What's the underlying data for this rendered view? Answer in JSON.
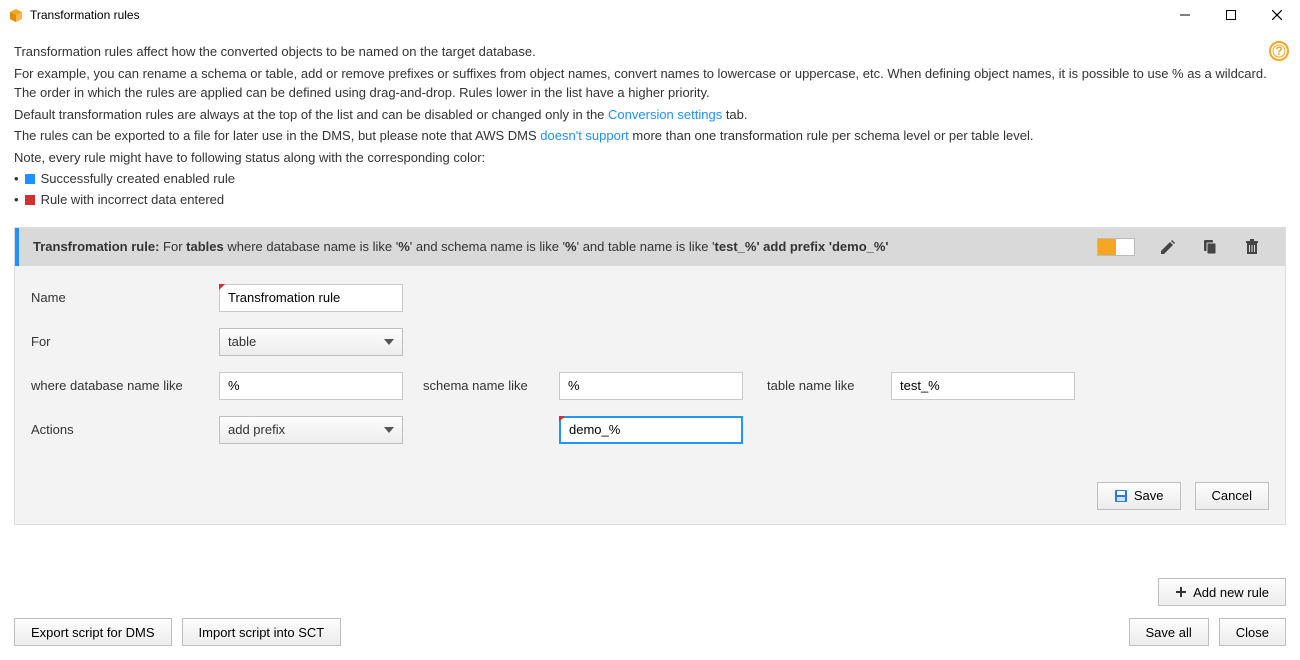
{
  "titlebar": {
    "title": "Transformation rules"
  },
  "intro": {
    "line1": "Transformation rules affect how the converted objects to be named on the target database.",
    "line2a": "For example, you can rename a schema or table, add or remove prefixes or suffixes from object names, convert names to lowercase or uppercase, etc. When defining object names, it is possible to use % as a wildcard. The order in which the rules are applied can be defined using drag-and-drop. Rules lower in the list have a higher priority.",
    "line3a": "Default transformation rules are always at the top of the list and can be disabled or changed only in the ",
    "line3_link": "Conversion settings",
    "line3b": "  tab.",
    "line4a": "The rules can be exported to a file for later use in the DMS, but please note that AWS DMS ",
    "line4_link": "doesn't support",
    "line4b": "  more than one transformation rule per schema level or per table level.",
    "line5": "Note, every rule might have to following status along with the corresponding color:",
    "bullet1": "Successfully created enabled rule",
    "bullet2": "Rule with incorrect data entered"
  },
  "rule": {
    "header_prefix": "Transfromation rule:",
    "header_for": " For  ",
    "header_tables": "tables",
    "header_mid1": "  where database name is like '",
    "header_pct1": "%",
    "header_mid2": "' and schema name is like '",
    "header_pct2": "%",
    "header_mid3": "' and table name is like '",
    "header_testpct": "test_%' add prefix 'demo_%'",
    "form": {
      "label_name": "Name",
      "value_name": "Transfromation rule",
      "label_for": "For",
      "value_for": "table",
      "label_dbname": "where database name like",
      "value_dbname": "%",
      "label_schema": "schema name like",
      "value_schema": "%",
      "label_table": "table name like",
      "value_table": "test_%",
      "label_actions": "Actions",
      "value_actions": "add prefix",
      "value_actionarg": "demo_%"
    },
    "buttons": {
      "save": "Save",
      "cancel": "Cancel"
    }
  },
  "footer": {
    "add_rule": "Add new rule",
    "export_dms": "Export script for DMS",
    "import_sct": "Import script into SCT",
    "save_all": "Save all",
    "close": "Close"
  }
}
